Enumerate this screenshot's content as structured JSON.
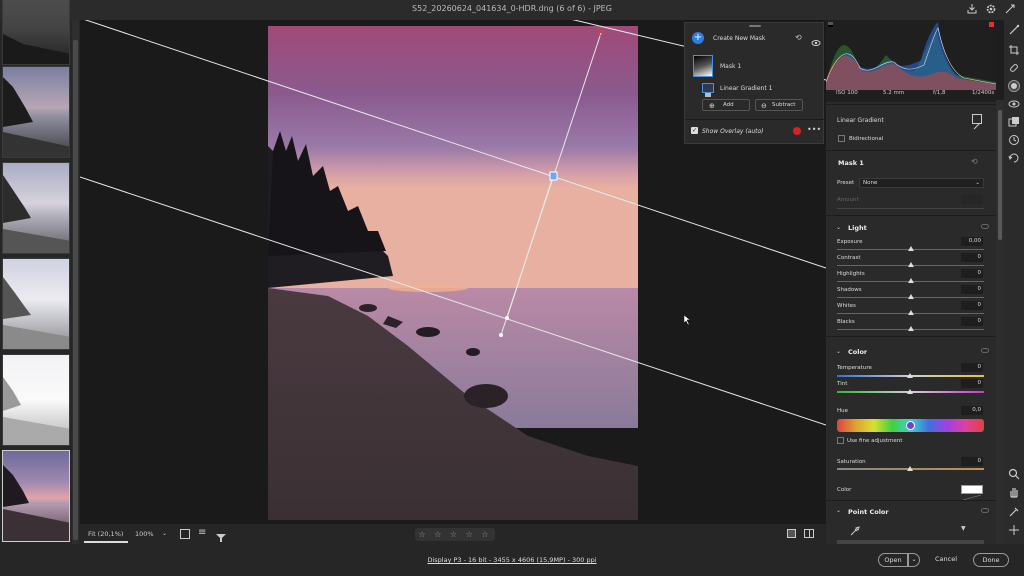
{
  "app": {
    "title": "S52_20260624_041634_0-HDR.dng (6 of 6)  -  JPEG"
  },
  "filmstrip": {
    "thumbnail_count": 6,
    "selected_index": 5
  },
  "mask_panel": {
    "create_label": "Create New Mask",
    "mask_name": "Mask 1",
    "component_name": "Linear Gradient 1",
    "add_label": "Add",
    "subtract_label": "Subtract",
    "overlay_label": "Show Overlay (auto)",
    "overlay_checked": true,
    "overlay_color": "#e02020"
  },
  "canvas_bottom": {
    "fit_label": "Fit (20,1%)",
    "zoom_label": "100%",
    "stars": "☆ ☆ ☆ ☆ ☆"
  },
  "footer": {
    "info": "Display P3 - 16 bit - 3455 x 4606 (15,9MP) - 300 ppi",
    "open_label": "Open",
    "cancel_label": "Cancel",
    "done_label": "Done"
  },
  "right_panel": {
    "exif": {
      "iso": "ISO 100",
      "focal": "5.2 mm",
      "aperture": "f/1,8",
      "shutter": "1/2400s"
    },
    "tool_header": "Linear Gradient",
    "bidirectional_label": "Bidirectional",
    "mask_header": "Mask 1",
    "preset_label": "Preset",
    "preset_value": "None",
    "amount_label": "Amount",
    "light": {
      "title": "Light",
      "sliders": [
        {
          "label": "Exposure",
          "value": "0,00",
          "position": 0.5
        },
        {
          "label": "Contrast",
          "value": "0",
          "position": 0.5
        },
        {
          "label": "Highlights",
          "value": "0",
          "position": 0.5
        },
        {
          "label": "Shadows",
          "value": "0",
          "position": 0.5
        },
        {
          "label": "Whites",
          "value": "0",
          "position": 0.5
        },
        {
          "label": "Blacks",
          "value": "0",
          "position": 0.5
        }
      ]
    },
    "color": {
      "title": "Color",
      "temperature_label": "Temperature",
      "temperature_value": "0",
      "tint_label": "Tint",
      "tint_value": "0",
      "hue_label": "Hue",
      "hue_value": "0,0",
      "hue_position": 0.5,
      "fine_adjust_label": "Use fine adjustment",
      "saturation_label": "Saturation",
      "saturation_value": "0",
      "color_label": "Color"
    },
    "point_color": {
      "title": "Point Color"
    }
  },
  "colors": {
    "accent": "#2f7de1",
    "panel_bg": "#2a2a2a",
    "canvas_bg": "#1a1a1a"
  },
  "icons": {
    "share": "share-icon",
    "settings": "gear-icon",
    "help": "help-icon"
  }
}
